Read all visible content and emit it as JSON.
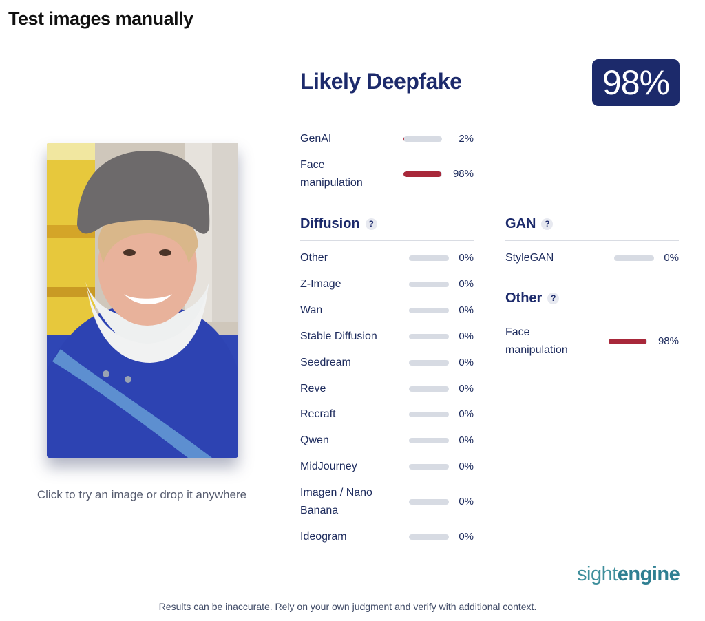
{
  "page": {
    "title": "Test images manually"
  },
  "upload": {
    "hint": "Click to try an image or drop it anywhere"
  },
  "result": {
    "verdict": "Likely Deepfake",
    "score_label": "98%",
    "summary": [
      {
        "label": "GenAI",
        "value": 0.02,
        "pct": "2%",
        "color": "#b03040"
      },
      {
        "label": "Face\nmanipulation",
        "value": 0.98,
        "pct": "98%",
        "color": "#a8283a"
      }
    ]
  },
  "sections": {
    "diffusion": {
      "title": "Diffusion",
      "help": "?",
      "items": [
        {
          "label": "Other",
          "value": 0,
          "pct": "0%"
        },
        {
          "label": "Z-Image",
          "value": 0,
          "pct": "0%"
        },
        {
          "label": "Wan",
          "value": 0,
          "pct": "0%"
        },
        {
          "label": "Stable Diffusion",
          "value": 0,
          "pct": "0%"
        },
        {
          "label": "Seedream",
          "value": 0,
          "pct": "0%"
        },
        {
          "label": "Reve",
          "value": 0,
          "pct": "0%"
        },
        {
          "label": "Recraft",
          "value": 0,
          "pct": "0%"
        },
        {
          "label": "Qwen",
          "value": 0,
          "pct": "0%"
        },
        {
          "label": "MidJourney",
          "value": 0,
          "pct": "0%"
        },
        {
          "label": "Imagen / Nano\nBanana",
          "value": 0,
          "pct": "0%"
        },
        {
          "label": "Ideogram",
          "value": 0,
          "pct": "0%"
        }
      ]
    },
    "gan": {
      "title": "GAN",
      "help": "?",
      "items": [
        {
          "label": "StyleGAN",
          "value": 0,
          "pct": "0%"
        }
      ]
    },
    "other": {
      "title": "Other",
      "help": "?",
      "items": [
        {
          "label": "Face\nmanipulation",
          "value": 0.98,
          "pct": "98%",
          "color": "#a8283a"
        }
      ]
    }
  },
  "brand": {
    "part1": "sight",
    "part2": "engine"
  },
  "footer": {
    "disclaimer": "Results can be inaccurate. Rely on your own judgment and verify with additional context."
  }
}
